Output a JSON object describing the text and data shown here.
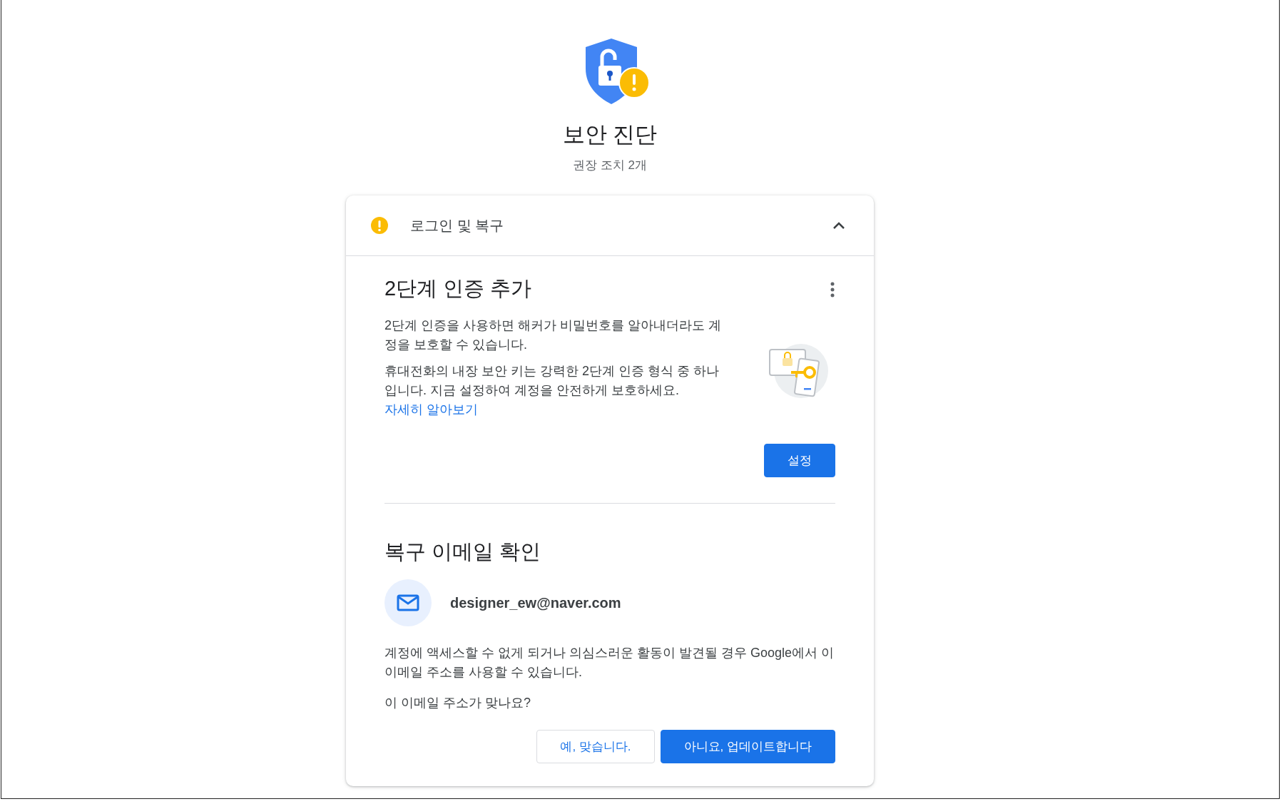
{
  "header": {
    "title": "보안 진단",
    "subtitle": "권장 조치 2개"
  },
  "section": {
    "title": "로그인 및 복구",
    "expanded": true,
    "items": [
      {
        "kind": "two_step",
        "title": "2단계 인증 추가",
        "paragraphs": [
          "2단계 인증을 사용하면 해커가 비밀번호를 알아내더라도 계정을 보호할 수 있습니다.",
          "휴대전화의 내장 보안 키는 강력한 2단계 인증 형식 중 하나입니다. 지금 설정하여 계정을 안전하게 보호하세요."
        ],
        "link": "자세히 알아보기",
        "button": "설정"
      },
      {
        "kind": "recovery_email",
        "title": "복구 이메일 확인",
        "email": "designer_ew@naver.com",
        "description": "계정에 액세스할 수 없게 되거나 의심스러운 활동이 발견될 경우 Google에서 이 이메일 주소를 사용할 수 있습니다.",
        "question": "이 이메일 주소가 맞나요?",
        "buttons": [
          {
            "label": "예, 맞습니다.",
            "primary": false
          },
          {
            "label": "아니요, 업데이트합니다",
            "primary": true
          }
        ]
      }
    ]
  }
}
